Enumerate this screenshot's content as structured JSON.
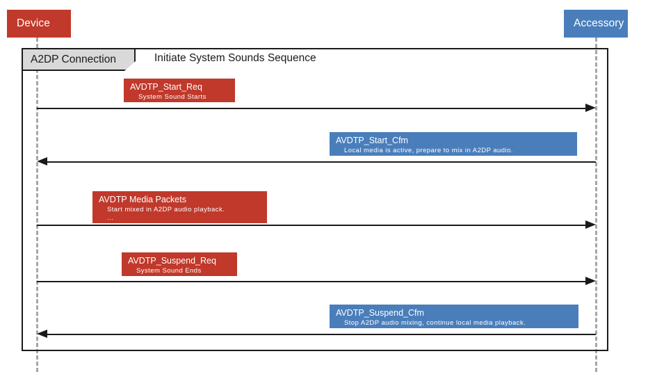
{
  "participants": [
    {
      "id": "device",
      "label": "Device",
      "color": "#C0392B",
      "side": "left"
    },
    {
      "id": "accessory",
      "label": "Accessory",
      "color": "#4A7EBB",
      "side": "right"
    }
  ],
  "fragment": {
    "operator_label": "A2DP Connection",
    "title": "Initiate System Sounds Sequence"
  },
  "messages": [
    {
      "id": "avdtp-start-req",
      "title": "AVDTP_Start_Req",
      "subtitle": "System Sound Starts",
      "extra": "",
      "direction": "right",
      "color": "#C0392B"
    },
    {
      "id": "avdtp-start-cfm",
      "title": "AVDTP_Start_Cfm",
      "subtitle": "Local media is active, prepare to mix in A2DP audio.",
      "extra": "",
      "direction": "left",
      "color": "#4A7EBB"
    },
    {
      "id": "avdtp-media-packets",
      "title": "AVDTP Media Packets",
      "subtitle": "Start mixed in A2DP audio playback.",
      "extra": "...",
      "direction": "right",
      "color": "#C0392B"
    },
    {
      "id": "avdtp-suspend-req",
      "title": "AVDTP_Suspend_Req",
      "subtitle": "System Sound Ends",
      "extra": "",
      "direction": "right",
      "color": "#C0392B"
    },
    {
      "id": "avdtp-suspend-cfm",
      "title": "AVDTP_Suspend_Cfm",
      "subtitle": "Stop A2DP audio mixing, continue local media playback.",
      "extra": "",
      "direction": "left",
      "color": "#4A7EBB"
    }
  ]
}
